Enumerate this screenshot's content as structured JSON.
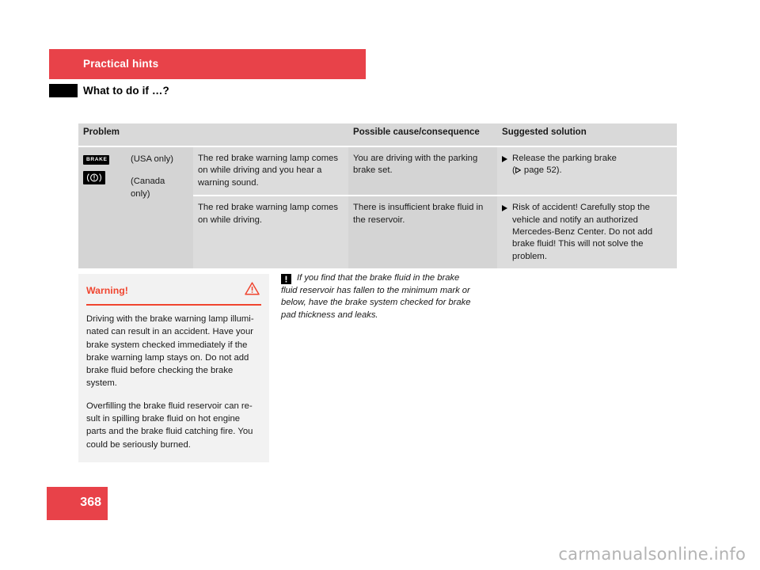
{
  "header": {
    "banner_title": "Practical hints",
    "section_title": "What to do if …?"
  },
  "table": {
    "columns": [
      "Problem",
      "Possible cause/consequence",
      "Suggested solution"
    ],
    "rows": [
      {
        "icons": [
          {
            "name": "brake-warning-lamp-icon",
            "label": "BRAKE"
          },
          {
            "name": "canada-brake-warning-lamp-icon",
            "label": "(!)"
          }
        ],
        "market_notes": [
          "(USA only)",
          "(Canada only)"
        ],
        "problem": "The red brake warning lamp comes on while driving and you hear a warning sound.",
        "cause": "You are driving with the parking brake set.",
        "solution": "Release the parking brake (",
        "solution_ref": " page 52).",
        "solution_full": "Release the parking brake"
      },
      {
        "problem": "The red brake warning lamp comes on while driving.",
        "cause": "There is insufficient brake fluid in the reservoir.",
        "solution": "Risk of accident! Carefully stop the vehicle and notify an authorized Mercedes-Benz Center. Do not add brake fluid! This will not solve the problem."
      }
    ]
  },
  "warning_box": {
    "title": "Warning!",
    "icon": "warning-triangle-icon",
    "paragraphs": [
      "Driving with the brake warning lamp illumi-nated can result in an accident. Have your brake system checked immediately if the brake warning lamp stays on. Do not add brake fluid before checking the brake system.",
      "Overfilling the brake fluid reservoir can re-sult in spilling brake fluid on hot engine parts and the brake fluid catching fire. You could be seriously burned."
    ]
  },
  "side_note": {
    "icon": "exclamation-note-icon",
    "text": "If you find that the brake fluid in the brake fluid reservoir has fallen to the minimum mark or below, have the brake system checked for brake pad thickness and leaks."
  },
  "footer": {
    "page_number": "368"
  },
  "watermark": {
    "text": "carmanualsonline.info"
  },
  "colors": {
    "brand_red": "#e84249",
    "warning_red": "#f0452f",
    "table_header_gray": "#d9d9d9",
    "table_shade_dark": "#d4d4d4",
    "table_shade_light": "#dcdcdc",
    "warning_box_bg": "#f2f2f2"
  }
}
